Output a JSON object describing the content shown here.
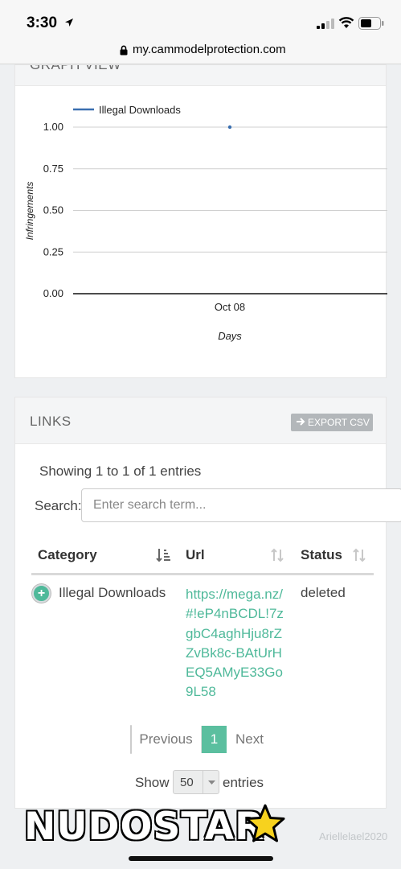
{
  "status_bar": {
    "time": "3:30"
  },
  "browser": {
    "url": "my.cammodelprotection.com"
  },
  "graph_panel": {
    "title": "GRAPH VIEW"
  },
  "chart_data": {
    "type": "line",
    "x": [
      "Oct 08"
    ],
    "series": [
      {
        "name": "Illegal Downloads",
        "values": [
          1.0
        ],
        "color": "#3a6fb0"
      }
    ],
    "xlabel": "Days",
    "ylabel": "Infringements",
    "ylim": [
      0,
      1
    ],
    "yticks": [
      "1.00",
      "0.75",
      "0.50",
      "0.25",
      "0.00"
    ],
    "grid": true,
    "legend": "top-left"
  },
  "links_panel": {
    "title": "LINKS",
    "export_label": "EXPORT CSV",
    "info": "Showing 1 to 1 of 1 entries",
    "search_label": "Search:",
    "search_placeholder": "Enter search term...",
    "columns": [
      "Category",
      "Url",
      "Status"
    ],
    "rows": [
      {
        "category": "Illegal Downloads",
        "url": "https://mega.nz/#!eP4nBCDL!7zgbC4aghHju8rZZvBk8c-BAtUrHEQ5AMyE33Go9L58",
        "status": "deleted"
      }
    ],
    "pagination": {
      "previous": "Previous",
      "current": "1",
      "next": "Next"
    },
    "length": {
      "show": "Show",
      "value": "50",
      "entries": "entries"
    }
  },
  "colors": {
    "accent": "#5bbf9f",
    "link": "#4fb99a",
    "line": "#3a6fb0"
  },
  "watermark": {
    "text": "NUDOSTAR",
    "credit": "Ariellelael2020"
  }
}
